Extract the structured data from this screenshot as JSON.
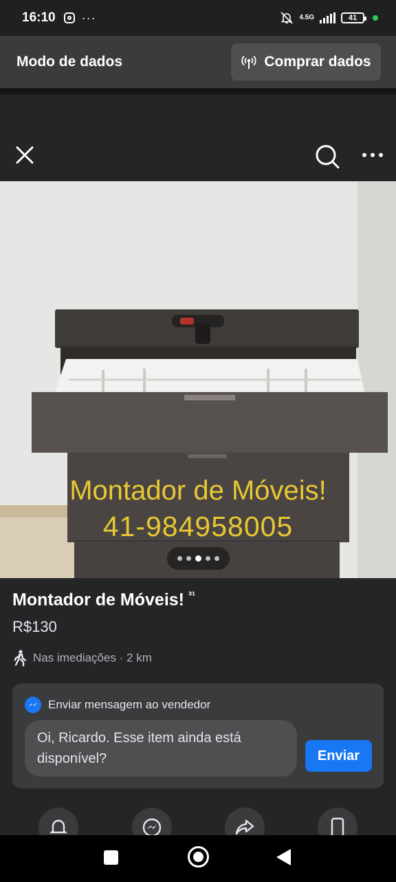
{
  "status_bar": {
    "time": "16:10",
    "network": "4.5G",
    "battery": "41",
    "icons": [
      "instagram-icon",
      "more-dots-icon",
      "mute-bell-icon",
      "signal-icon",
      "battery-icon"
    ]
  },
  "data_banner": {
    "title": "Modo de dados",
    "buy_button_label": "Comprar dados"
  },
  "topbar": {
    "icons": [
      "close-icon",
      "search-icon",
      "more-icon"
    ]
  },
  "photo": {
    "overlay_line_1": "Montador de Móveis!",
    "overlay_line_2": "41-984958005",
    "carousel": {
      "total": 5,
      "active_index": 2
    }
  },
  "listing": {
    "title": "Montador de Móveis!",
    "title_suffix": "³¹",
    "price": "R$130",
    "location": "Nas imediações · 2 km"
  },
  "message": {
    "header": "Enviar mensagem ao vendedor",
    "input_value": "Oi, Ricardo. Esse item ainda está disponível?",
    "send_label": "Enviar"
  },
  "actions": {
    "icons": [
      "bell-icon",
      "messenger-icon",
      "share-icon",
      "phone-icon"
    ]
  },
  "colors": {
    "background": "#242526",
    "card": "#3a3b3c",
    "accent": "#1877f2",
    "watermark": "#e8c832"
  }
}
